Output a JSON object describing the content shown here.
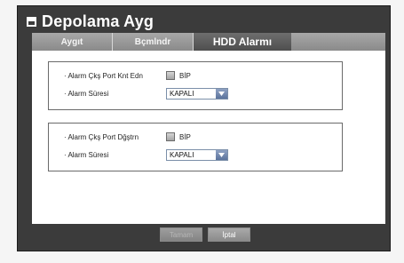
{
  "window": {
    "title": "Depolama Ayg"
  },
  "tabs": [
    {
      "label": "Aygıt",
      "active": false
    },
    {
      "label": "Bçmlndr",
      "active": false
    },
    {
      "label": "HDD Alarmı",
      "active": true
    }
  ],
  "groups": [
    {
      "output_label": "· Alarm Çkş Port Knt Edn",
      "output_checkbox_label": "BİP",
      "output_checked": false,
      "duration_label": "· Alarm Süresi",
      "duration_value": "KAPALI"
    },
    {
      "output_label": "· Alarm Çkş Port Dğştrn",
      "output_checkbox_label": "BİP",
      "output_checked": false,
      "duration_label": "· Alarm Süresi",
      "duration_value": "KAPALI"
    }
  ],
  "footer": {
    "ok_label": "Tamam",
    "ok_enabled": false,
    "cancel_label": "İptal"
  },
  "colors": {
    "frame": "#3b3b3b",
    "active_tab": "#5a5a5a",
    "inactive_tab": "#9a9a9a",
    "dropdown_arrow": "#6f86ad",
    "panel": "#ffffff"
  },
  "icons": {
    "title": "menu-window-icon",
    "dropdown": "chevron-down-icon"
  }
}
